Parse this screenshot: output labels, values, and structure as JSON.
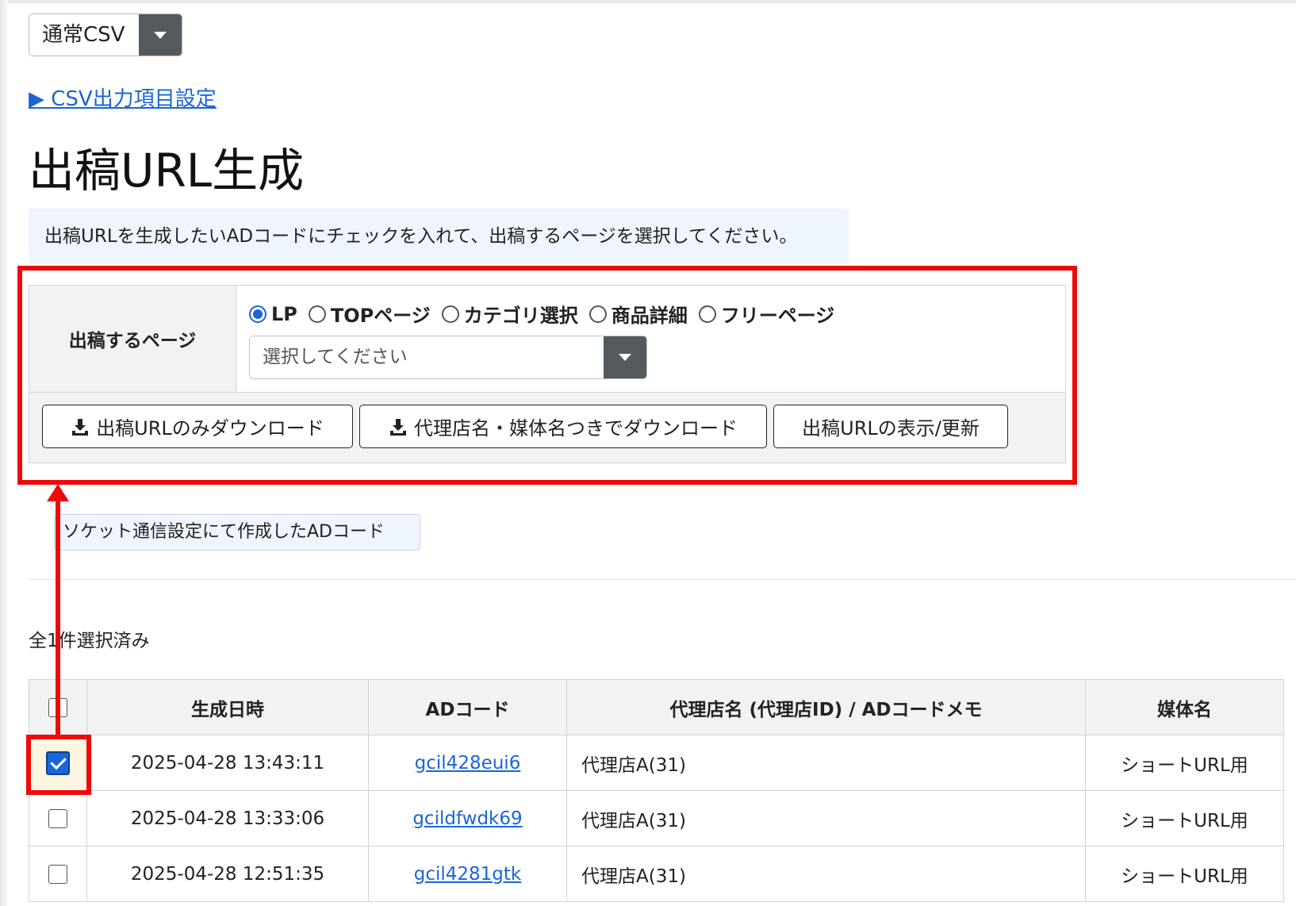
{
  "csv_select": {
    "value": "通常CSV"
  },
  "csv_link": {
    "label": "▶ CSV出力項目設定"
  },
  "page_title": "出稿URL生成",
  "info_text": "出稿URLを生成したいADコードにチェックを入れて、出稿するページを選択してください。",
  "form": {
    "label": "出稿するページ",
    "radios": [
      {
        "label": "LP",
        "checked": true
      },
      {
        "label": "TOPページ",
        "checked": false
      },
      {
        "label": "カテゴリ選択",
        "checked": false
      },
      {
        "label": "商品詳細",
        "checked": false
      },
      {
        "label": "フリーページ",
        "checked": false
      }
    ],
    "page_select_placeholder": "選択してください",
    "buttons": {
      "download_url_only": "出稿URLのみダウンロード",
      "download_with_names": "代理店名・媒体名つきでダウンロード",
      "show_update": "出稿URLの表示/更新"
    }
  },
  "socket_badge": "ソケット通信設定にて作成したADコード",
  "selected_count": "全1件選択済み",
  "table": {
    "headers": [
      "生成日時",
      "ADコード",
      "代理店名 (代理店ID) / ADコードメモ",
      "媒体名"
    ],
    "rows": [
      {
        "checked": true,
        "date": "2025-04-28 13:43:11",
        "ad_code": "gcil428eui6",
        "agency": "代理店A(31)",
        "media": "ショートURL用"
      },
      {
        "checked": false,
        "date": "2025-04-28 13:33:06",
        "ad_code": "gcildfwdk69",
        "agency": "代理店A(31)",
        "media": "ショートURL用"
      },
      {
        "checked": false,
        "date": "2025-04-28 12:51:35",
        "ad_code": "gcil4281gtk",
        "agency": "代理店A(31)",
        "media": "ショートURL用"
      }
    ]
  },
  "colors": {
    "accent": "#1a66d6",
    "highlight": "#ee0a0a"
  }
}
